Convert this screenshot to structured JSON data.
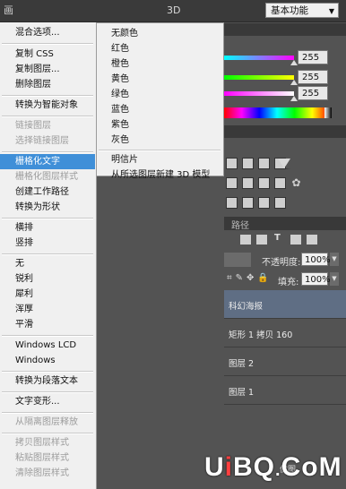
{
  "topbar": {
    "left_glyph": "画",
    "center_label": "3D",
    "workspace": "基本功能"
  },
  "sliders": [
    {
      "value": "255",
      "gradient": "linear-gradient(90deg,#00ffff,#ff00ff)"
    },
    {
      "value": "255",
      "gradient": "linear-gradient(90deg,#00ff00,#ffff00)"
    },
    {
      "value": "255",
      "gradient": "linear-gradient(90deg,#ff00ff,#ffffff)"
    }
  ],
  "layers_panel": {
    "tab_paths": "路径",
    "opacity_label": "不透明度:",
    "opacity_value": "100%",
    "fill_label": "填充:",
    "fill_value": "100%",
    "rows": [
      "科幻海报",
      "矩形 1 拷贝 160",
      "图层 2",
      "图层 1"
    ]
  },
  "main_menu": {
    "items": [
      {
        "label": "混合选项...",
        "disabled": false
      },
      {
        "label": "复制 CSS",
        "disabled": false
      },
      {
        "label": "复制图层...",
        "disabled": false
      },
      {
        "label": "删除图层",
        "disabled": false
      },
      {
        "label": "转换为智能对象",
        "disabled": false
      },
      {
        "label": "链接图层",
        "disabled": true
      },
      {
        "label": "选择链接图层",
        "disabled": true
      },
      {
        "label": "栅格化文字",
        "disabled": false,
        "highlighted": true
      },
      {
        "label": "栅格化图层样式",
        "disabled": true
      },
      {
        "label": "创建工作路径",
        "disabled": false
      },
      {
        "label": "转换为形状",
        "disabled": false
      },
      {
        "label": "横排",
        "disabled": false
      },
      {
        "label": "竖排",
        "disabled": false
      },
      {
        "label": "无",
        "disabled": false
      },
      {
        "label": "锐利",
        "disabled": false
      },
      {
        "label": "犀利",
        "disabled": false
      },
      {
        "label": "浑厚",
        "disabled": false
      },
      {
        "label": "平滑",
        "disabled": false
      },
      {
        "label": "Windows LCD",
        "disabled": false
      },
      {
        "label": "Windows",
        "disabled": false
      },
      {
        "label": "转换为段落文本",
        "disabled": false
      },
      {
        "label": "文字变形...",
        "disabled": false
      },
      {
        "label": "从隔离图层释放",
        "disabled": true
      },
      {
        "label": "拷贝图层样式",
        "disabled": true
      },
      {
        "label": "粘贴图层样式",
        "disabled": true
      },
      {
        "label": "清除图层样式",
        "disabled": true
      }
    ]
  },
  "sub_menu": {
    "items": [
      {
        "label": "无颜色"
      },
      {
        "label": "红色"
      },
      {
        "label": "橙色"
      },
      {
        "label": "黄色"
      },
      {
        "label": "绿色"
      },
      {
        "label": "蓝色"
      },
      {
        "label": "紫色"
      },
      {
        "label": "灰色"
      },
      {
        "label": "明信片"
      },
      {
        "label": "从所选图层新建 3D 模型"
      }
    ]
  },
  "watermark": {
    "u": "U",
    "i": "i",
    "bq": "BQ",
    "dot": ".",
    "com": "CoM",
    "small": "优图"
  }
}
